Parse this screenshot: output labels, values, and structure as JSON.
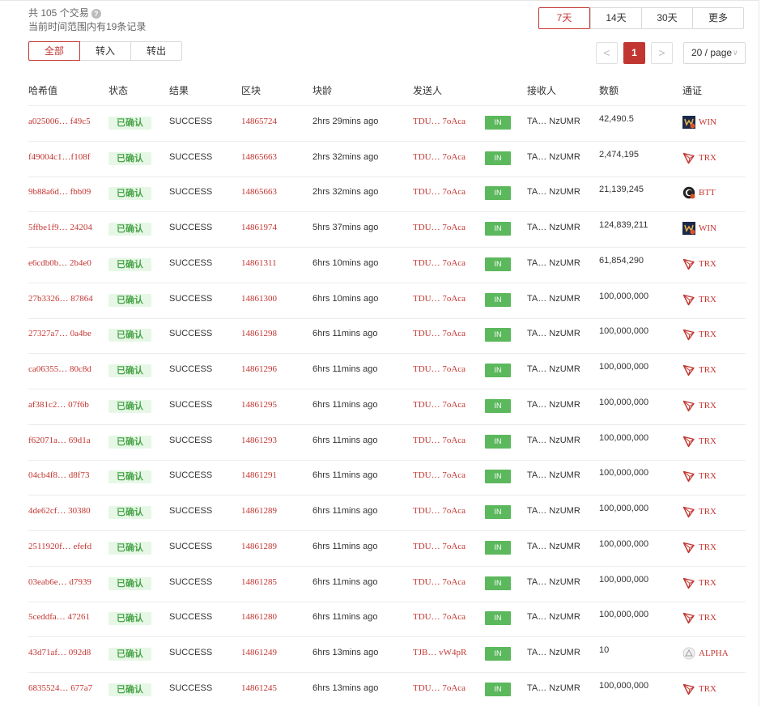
{
  "summary": {
    "total": "共 105 个交易",
    "help_icon": "?",
    "range_records": "当前时间范围内有19条记录"
  },
  "time_range": {
    "options": [
      "7天",
      "14天",
      "30天",
      "更多"
    ],
    "active": "7天"
  },
  "direction": {
    "options": [
      "全部",
      "转入",
      "转出"
    ],
    "active": "全部"
  },
  "pagination": {
    "prev": "<",
    "current": "1",
    "next": ">",
    "page_size": "20 / page",
    "page_size_chevron": "∨"
  },
  "table": {
    "headers": {
      "hash": "哈希值",
      "status": "状态",
      "result": "结果",
      "block": "区块",
      "age": "块龄",
      "from": "发送人",
      "to": "接收人",
      "amount": "数额",
      "token": "通证"
    },
    "rows": [
      {
        "hash": "a025006… f49c5",
        "status": "已确认",
        "result": "SUCCESS",
        "block": "14865724",
        "age": "2hrs 29mins ago",
        "from": "TDU… 7oAca",
        "dir": "IN",
        "to": "TA… NzUMR",
        "amount": "42,490.5",
        "token": "WIN",
        "token_icon": "win-icon"
      },
      {
        "hash": "f49004c1…f108f",
        "status": "已确认",
        "result": "SUCCESS",
        "block": "14865663",
        "age": "2hrs 32mins ago",
        "from": "TDU… 7oAca",
        "dir": "IN",
        "to": "TA… NzUMR",
        "amount": "2,474,195",
        "token": "TRX",
        "token_icon": "trx-icon"
      },
      {
        "hash": "9b88a6d… fbb09",
        "status": "已确认",
        "result": "SUCCESS",
        "block": "14865663",
        "age": "2hrs 32mins ago",
        "from": "TDU… 7oAca",
        "dir": "IN",
        "to": "TA… NzUMR",
        "amount": "21,139,245",
        "token": "BTT",
        "token_icon": "btt-icon"
      },
      {
        "hash": "5ffbe1f9… 24204",
        "status": "已确认",
        "result": "SUCCESS",
        "block": "14861974",
        "age": "5hrs 37mins ago",
        "from": "TDU… 7oAca",
        "dir": "IN",
        "to": "TA… NzUMR",
        "amount": "124,839,211",
        "token": "WIN",
        "token_icon": "win-icon"
      },
      {
        "hash": "e6cdb0b… 2b4e0",
        "status": "已确认",
        "result": "SUCCESS",
        "block": "14861311",
        "age": "6hrs 10mins ago",
        "from": "TDU… 7oAca",
        "dir": "IN",
        "to": "TA… NzUMR",
        "amount": "61,854,290",
        "token": "TRX",
        "token_icon": "trx-icon"
      },
      {
        "hash": "27b3326… 87864",
        "status": "已确认",
        "result": "SUCCESS",
        "block": "14861300",
        "age": "6hrs 10mins ago",
        "from": "TDU… 7oAca",
        "dir": "IN",
        "to": "TA… NzUMR",
        "amount": "100,000,000",
        "token": "TRX",
        "token_icon": "trx-icon"
      },
      {
        "hash": "27327a7… 0a4be",
        "status": "已确认",
        "result": "SUCCESS",
        "block": "14861298",
        "age": "6hrs 11mins ago",
        "from": "TDU… 7oAca",
        "dir": "IN",
        "to": "TA… NzUMR",
        "amount": "100,000,000",
        "token": "TRX",
        "token_icon": "trx-icon"
      },
      {
        "hash": "ca06355… 80c8d",
        "status": "已确认",
        "result": "SUCCESS",
        "block": "14861296",
        "age": "6hrs 11mins ago",
        "from": "TDU… 7oAca",
        "dir": "IN",
        "to": "TA… NzUMR",
        "amount": "100,000,000",
        "token": "TRX",
        "token_icon": "trx-icon"
      },
      {
        "hash": "af381c2… 07f6b",
        "status": "已确认",
        "result": "SUCCESS",
        "block": "14861295",
        "age": "6hrs 11mins ago",
        "from": "TDU… 7oAca",
        "dir": "IN",
        "to": "TA… NzUMR",
        "amount": "100,000,000",
        "token": "TRX",
        "token_icon": "trx-icon"
      },
      {
        "hash": "f62071a… 69d1a",
        "status": "已确认",
        "result": "SUCCESS",
        "block": "14861293",
        "age": "6hrs 11mins ago",
        "from": "TDU… 7oAca",
        "dir": "IN",
        "to": "TA… NzUMR",
        "amount": "100,000,000",
        "token": "TRX",
        "token_icon": "trx-icon"
      },
      {
        "hash": "04cb4f8… d8f73",
        "status": "已确认",
        "result": "SUCCESS",
        "block": "14861291",
        "age": "6hrs 11mins ago",
        "from": "TDU… 7oAca",
        "dir": "IN",
        "to": "TA… NzUMR",
        "amount": "100,000,000",
        "token": "TRX",
        "token_icon": "trx-icon"
      },
      {
        "hash": "4de62cf… 30380",
        "status": "已确认",
        "result": "SUCCESS",
        "block": "14861289",
        "age": "6hrs 11mins ago",
        "from": "TDU… 7oAca",
        "dir": "IN",
        "to": "TA… NzUMR",
        "amount": "100,000,000",
        "token": "TRX",
        "token_icon": "trx-icon"
      },
      {
        "hash": "2511920f… efefd",
        "status": "已确认",
        "result": "SUCCESS",
        "block": "14861289",
        "age": "6hrs 11mins ago",
        "from": "TDU… 7oAca",
        "dir": "IN",
        "to": "TA… NzUMR",
        "amount": "100,000,000",
        "token": "TRX",
        "token_icon": "trx-icon"
      },
      {
        "hash": "03eab6e… d7939",
        "status": "已确认",
        "result": "SUCCESS",
        "block": "14861285",
        "age": "6hrs 11mins ago",
        "from": "TDU… 7oAca",
        "dir": "IN",
        "to": "TA… NzUMR",
        "amount": "100,000,000",
        "token": "TRX",
        "token_icon": "trx-icon"
      },
      {
        "hash": "5ceddfa… 47261",
        "status": "已确认",
        "result": "SUCCESS",
        "block": "14861280",
        "age": "6hrs 11mins ago",
        "from": "TDU… 7oAca",
        "dir": "IN",
        "to": "TA… NzUMR",
        "amount": "100,000,000",
        "token": "TRX",
        "token_icon": "trx-icon"
      },
      {
        "hash": "43d71af… 092d8",
        "status": "已确认",
        "result": "SUCCESS",
        "block": "14861249",
        "age": "6hrs 13mins ago",
        "from": "TJB… vW4pR",
        "dir": "IN",
        "to": "TA… NzUMR",
        "amount": "10",
        "token": "ALPHA",
        "token_icon": "alpha-icon"
      },
      {
        "hash": "6835524… 677a7",
        "status": "已确认",
        "result": "SUCCESS",
        "block": "14861245",
        "age": "6hrs 13mins ago",
        "from": "TDU… 7oAca",
        "dir": "IN",
        "to": "TA… NzUMR",
        "amount": "100,000,000",
        "token": "TRX",
        "token_icon": "trx-icon"
      }
    ]
  },
  "colors": {
    "accent": "#c23631",
    "status_bg": "#e6f7e6",
    "status_text": "#4aa54a",
    "in_badge": "#5cb85c"
  }
}
